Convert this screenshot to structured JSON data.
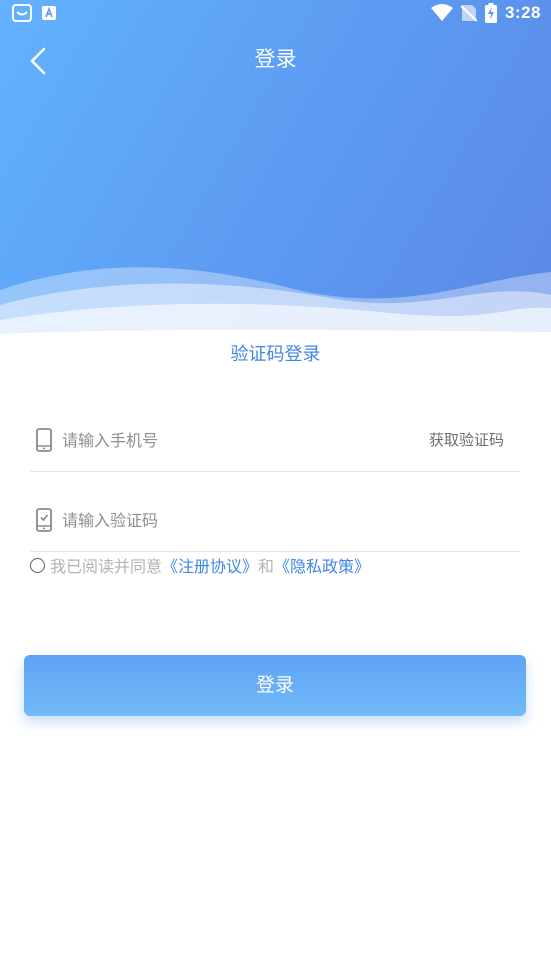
{
  "status_bar": {
    "time": "3:28",
    "left_icons": [
      "tray-icon",
      "text-badge-icon"
    ],
    "right_icons": [
      "wifi-icon",
      "no-sim-icon",
      "battery-charging-icon"
    ]
  },
  "header": {
    "title": "登录",
    "back_icon": "chevron-left-icon"
  },
  "login_type": "验证码登录",
  "phone_field": {
    "placeholder": "请输入手机号",
    "value": "",
    "icon": "phone-icon",
    "get_code_label": "获取验证码"
  },
  "code_field": {
    "placeholder": "请输入验证码",
    "value": "",
    "icon": "verification-phone-icon"
  },
  "agreement": {
    "checked": false,
    "prefix": "我已阅读并同意",
    "terms_link": "《注册协议》",
    "conjunction": "和",
    "privacy_link": "《隐私政策》"
  },
  "login_button": {
    "label": "登录"
  },
  "colors": {
    "header_gradient_start": "#62b2ff",
    "header_gradient_end": "#5b88e6",
    "accent": "#3f86e6",
    "button_gradient_start": "#5ea3f6",
    "button_gradient_end": "#71baf7",
    "muted_text": "#b3b3b3"
  }
}
